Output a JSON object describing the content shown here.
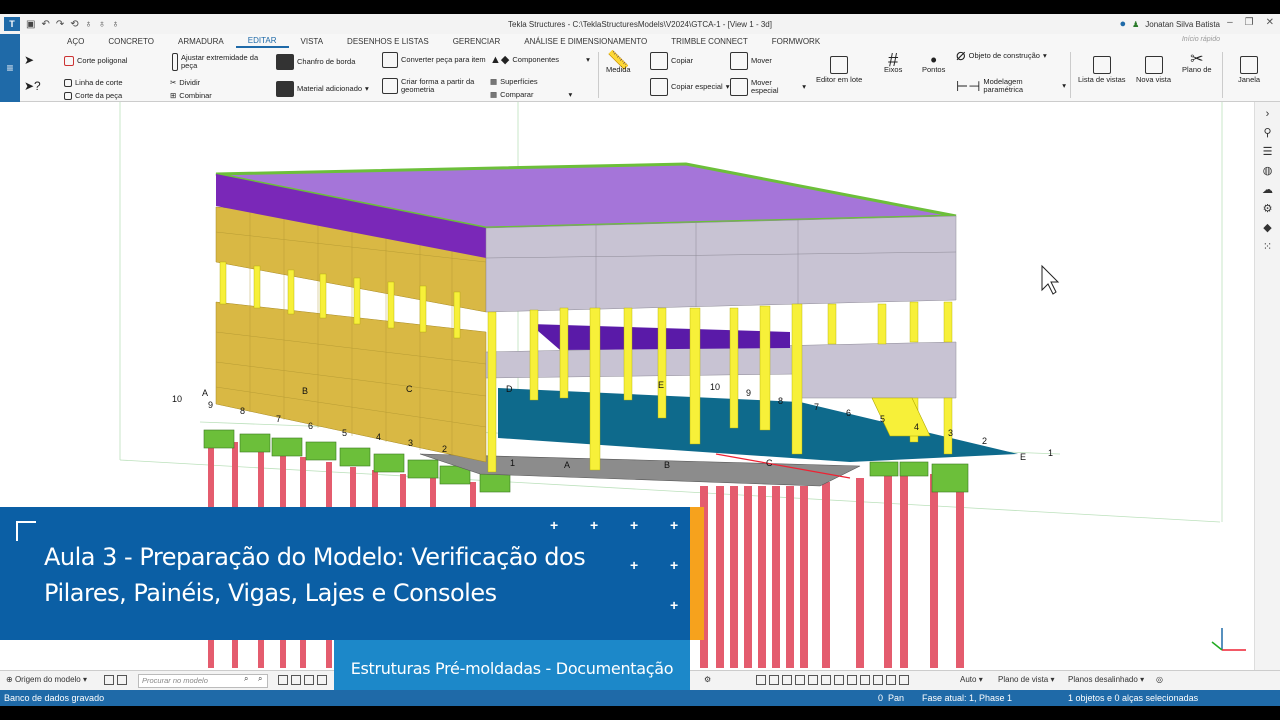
{
  "titlebar": {
    "title": "Tekla Structures - C:\\TeklaStructuresModels\\V2024\\GTCA-1 - [View 1 - 3d]",
    "user": "Jonatan Silva Batista",
    "quick_search": "Início rápido"
  },
  "menu": {
    "items": [
      "AÇO",
      "CONCRETO",
      "ARMADURA",
      "EDITAR",
      "VISTA",
      "DESENHOS E LISTAS",
      "GERENCIAR",
      "ANÁLISE E DIMENSIONAMENTO",
      "TRIMBLE CONNECT",
      "FORMWORK"
    ],
    "active": "EDITAR"
  },
  "ribbon": {
    "corte_poligonal": "Corte poligonal",
    "linha_de_corte": "Linha de corte",
    "corte_da_peca": "Corte da peça",
    "ajustar": "Ajustar extremidade da peça",
    "dividir": "Dividir",
    "combinar": "Combinar",
    "chanfro": "Chanfro de borda",
    "material": "Material adicionado",
    "converter": "Converter peça para item",
    "criar_forma": "Criar forma a partir da geometria",
    "componentes": "Componentes",
    "superficies": "Superfícies",
    "comparar": "Comparar",
    "medida": "Medida",
    "copiar": "Copiar",
    "copiar_especial": "Copiar especial",
    "mover": "Mover",
    "mover_especial": "Mover especial",
    "editor_lote": "Editor em lote",
    "eixos": "Eixos",
    "pontos": "Pontos",
    "objeto_construcao": "Objeto de construção",
    "modelagem_parametrica": "Modelagem paramétrica",
    "lista_vistas": "Lista de vistas",
    "nova_vista": "Nova vista",
    "plano_de": "Plano de",
    "janela": "Janela"
  },
  "model": {
    "grid_letters": [
      "A",
      "B",
      "C",
      "D",
      "E"
    ],
    "grid_numbers": [
      "1",
      "2",
      "3",
      "4",
      "5",
      "6",
      "7",
      "8",
      "9",
      "10"
    ]
  },
  "banner": {
    "title": "Aula 3 - Preparação do Modelo: Verificação dos Pilares, Painéis, Vigas, Lajes e Consoles",
    "subtitle": "Estruturas Pré-moldadas - Documentação"
  },
  "toolbar2": {
    "origem": "Origem do modelo",
    "search_placeholder": "Procurar no modelo",
    "auto": "Auto",
    "plano_vista": "Plano de vista",
    "planos_desalinhado": "Planos desalinhado"
  },
  "status": {
    "left": "Banco de dados gravado",
    "pan_value": "0",
    "pan": "Pan",
    "phase": "Fase atual: 1, Phase 1",
    "selection": "1 objetos e 0 alças selecionadas"
  },
  "colors": {
    "accent": "#1f6aa8",
    "banner": "#0b5fa5",
    "orange": "#f6a21d",
    "subbanner": "#1c88c9"
  }
}
